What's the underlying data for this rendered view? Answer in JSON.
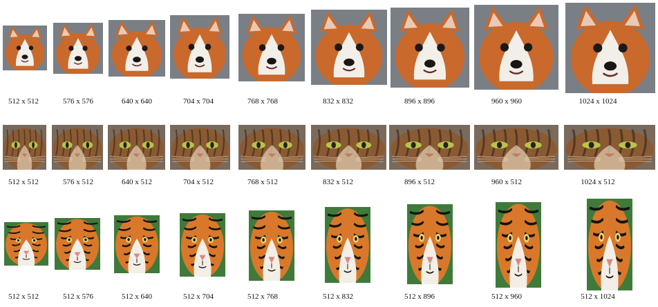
{
  "figure": {
    "rows": [
      {
        "subject": "corgi",
        "palette": {
          "bg": "#7a7f86",
          "fur": "#c9692c",
          "light": "#f2efe9",
          "dark": "#1c1a19",
          "nose": "#1a1616"
        },
        "labels": [
          "512 x 512",
          "576 x 576",
          "640 x 640",
          "704 x 704",
          "768 x 768",
          "832 x 832",
          "896 x 896",
          "960 x 960",
          "1024 x 1024"
        ]
      },
      {
        "subject": "tabby-cat",
        "palette": {
          "bg": "#7a6a5c",
          "fur": "#8a5a33",
          "light": "#d8c2a4",
          "dark": "#2a1f18",
          "eye": "#b7c44a",
          "nose": "#c07a66"
        },
        "labels": [
          "512 x 512",
          "576 x 512",
          "640 x 512",
          "704 x 512",
          "768 x 512",
          "832 x 512",
          "896 x 512",
          "960 x 512",
          "1024 x 512"
        ]
      },
      {
        "subject": "tiger",
        "palette": {
          "bg": "#3f7a3a",
          "fur": "#d9782a",
          "light": "#f3eee6",
          "dark": "#141414",
          "nose": "#d98a8a"
        },
        "labels": [
          "512 x 512",
          "512 x 576",
          "512 x 640",
          "512 x 704",
          "512 x 768",
          "512 x 832",
          "512 x 896",
          "512 x 960",
          "512 x 1024"
        ]
      }
    ]
  }
}
